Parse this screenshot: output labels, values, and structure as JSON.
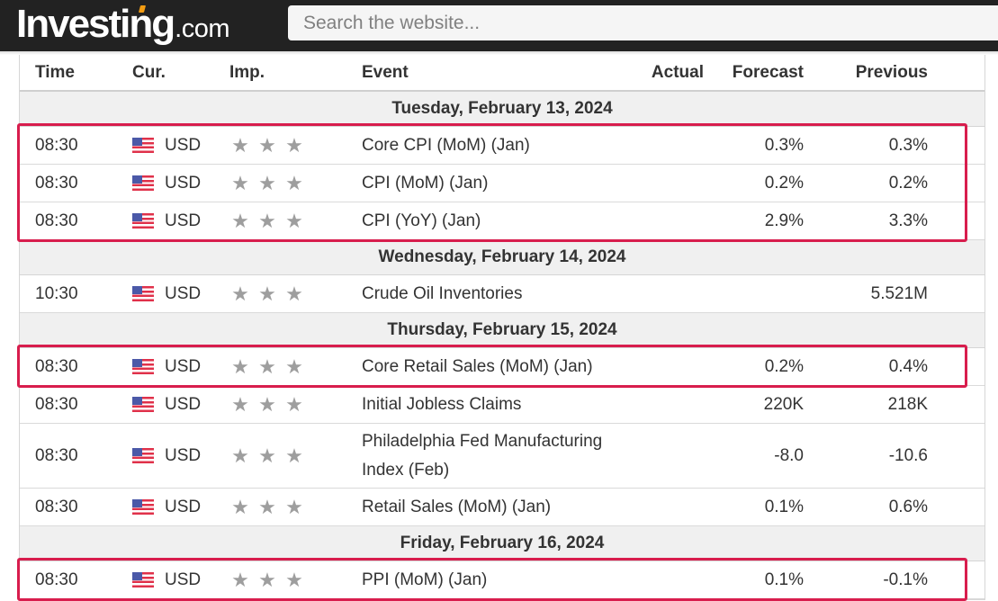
{
  "header": {
    "logo_brand": "Investing",
    "logo_tld": ".com",
    "search_placeholder": "Search the website..."
  },
  "table": {
    "columns": {
      "time": "Time",
      "currency": "Cur.",
      "importance": "Imp.",
      "event": "Event",
      "actual": "Actual",
      "forecast": "Forecast",
      "previous": "Previous"
    },
    "days": [
      {
        "date": "Tuesday, February 13, 2024",
        "events": [
          {
            "time": "08:30",
            "currency": "USD",
            "flag_icon": "us-flag-icon",
            "importance_stars": 3,
            "event": "Core CPI (MoM) (Jan)",
            "actual": "",
            "forecast": "0.3%",
            "previous": "0.3%",
            "highlighted": true
          },
          {
            "time": "08:30",
            "currency": "USD",
            "flag_icon": "us-flag-icon",
            "importance_stars": 3,
            "event": "CPI (MoM) (Jan)",
            "actual": "",
            "forecast": "0.2%",
            "previous": "0.2%",
            "highlighted": true
          },
          {
            "time": "08:30",
            "currency": "USD",
            "flag_icon": "us-flag-icon",
            "importance_stars": 3,
            "event": "CPI (YoY) (Jan)",
            "actual": "",
            "forecast": "2.9%",
            "previous": "3.3%",
            "highlighted": true
          }
        ]
      },
      {
        "date": "Wednesday, February 14, 2024",
        "events": [
          {
            "time": "10:30",
            "currency": "USD",
            "flag_icon": "us-flag-icon",
            "importance_stars": 3,
            "event": "Crude Oil Inventories",
            "actual": "",
            "forecast": "",
            "previous": "5.521M",
            "highlighted": false
          }
        ]
      },
      {
        "date": "Thursday, February 15, 2024",
        "events": [
          {
            "time": "08:30",
            "currency": "USD",
            "flag_icon": "us-flag-icon",
            "importance_stars": 3,
            "event": "Core Retail Sales (MoM) (Jan)",
            "actual": "",
            "forecast": "0.2%",
            "previous": "0.4%",
            "highlighted": true
          },
          {
            "time": "08:30",
            "currency": "USD",
            "flag_icon": "us-flag-icon",
            "importance_stars": 3,
            "event": "Initial Jobless Claims",
            "actual": "",
            "forecast": "220K",
            "previous": "218K",
            "highlighted": false
          },
          {
            "time": "08:30",
            "currency": "USD",
            "flag_icon": "us-flag-icon",
            "importance_stars": 3,
            "event": "Philadelphia Fed Manufacturing Index (Feb)",
            "actual": "",
            "forecast": "-8.0",
            "previous": "-10.6",
            "highlighted": false
          },
          {
            "time": "08:30",
            "currency": "USD",
            "flag_icon": "us-flag-icon",
            "importance_stars": 3,
            "event": "Retail Sales (MoM) (Jan)",
            "actual": "",
            "forecast": "0.1%",
            "previous": "0.6%",
            "highlighted": false
          }
        ]
      },
      {
        "date": "Friday, February 16, 2024",
        "events": [
          {
            "time": "08:30",
            "currency": "USD",
            "flag_icon": "us-flag-icon",
            "importance_stars": 3,
            "event": "PPI (MoM) (Jan)",
            "actual": "",
            "forecast": "0.1%",
            "previous": "-0.1%",
            "highlighted": true
          }
        ]
      }
    ]
  },
  "colors": {
    "topbar": "#222222",
    "highlight": "#d81d4d",
    "date_row": "#f0f0f0",
    "star": "#9e9e9e"
  }
}
